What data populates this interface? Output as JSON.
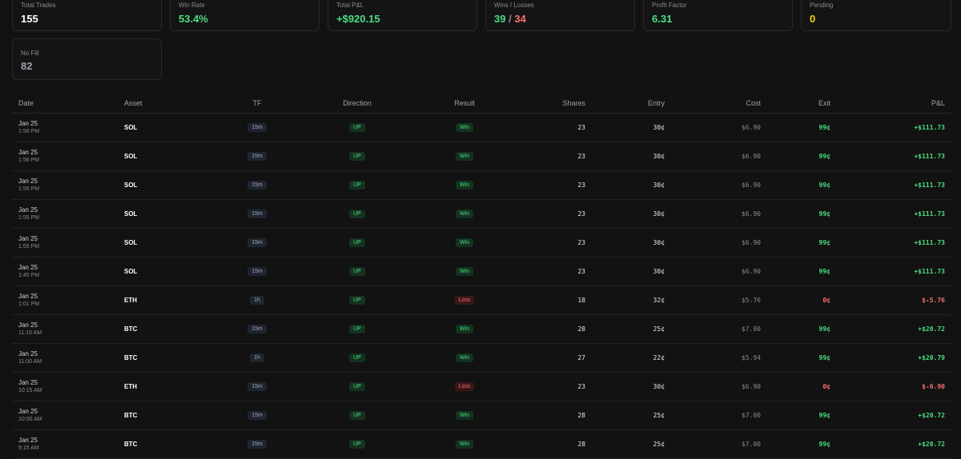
{
  "stats": [
    {
      "label": "Total Trades",
      "value": "155",
      "color": "white"
    },
    {
      "label": "Win Rate",
      "value": "53.4%",
      "color": "green"
    },
    {
      "label": "Total P&L",
      "value": "+$920.15",
      "color": "green"
    },
    {
      "label": "Wins / Losses",
      "wins": "39",
      "losses": "34",
      "separator": "/"
    },
    {
      "label": "Profit Factor",
      "value": "6.31",
      "color": "green"
    },
    {
      "label": "Pending",
      "value": "0",
      "color": "yellow"
    },
    {
      "label": "No Fill",
      "value": "82",
      "color": "grey"
    }
  ],
  "table": {
    "headers": {
      "date": "Date",
      "asset": "Asset",
      "tf": "TF",
      "direction": "Direction",
      "result": "Result",
      "shares": "Shares",
      "entry": "Entry",
      "cost": "Cost",
      "exit": "Exit",
      "pnl": "P&L"
    },
    "rows": [
      {
        "date": "Jan 25",
        "time": "1:56 PM",
        "asset": "SOL",
        "tf": "15m",
        "direction": "UP",
        "result": "Win",
        "shares": "23",
        "entry": "30¢",
        "cost": "$6.90",
        "exit": "99¢",
        "pnl": "+$111.73"
      },
      {
        "date": "Jan 25",
        "time": "1:56 PM",
        "asset": "SOL",
        "tf": "15m",
        "direction": "UP",
        "result": "Win",
        "shares": "23",
        "entry": "30¢",
        "cost": "$6.90",
        "exit": "99¢",
        "pnl": "+$111.73"
      },
      {
        "date": "Jan 25",
        "time": "1:56 PM",
        "asset": "SOL",
        "tf": "15m",
        "direction": "UP",
        "result": "Win",
        "shares": "23",
        "entry": "30¢",
        "cost": "$6.90",
        "exit": "99¢",
        "pnl": "+$111.73"
      },
      {
        "date": "Jan 25",
        "time": "1:55 PM",
        "asset": "SOL",
        "tf": "15m",
        "direction": "UP",
        "result": "Win",
        "shares": "23",
        "entry": "30¢",
        "cost": "$6.90",
        "exit": "99¢",
        "pnl": "+$111.73"
      },
      {
        "date": "Jan 25",
        "time": "1:55 PM",
        "asset": "SOL",
        "tf": "15m",
        "direction": "UP",
        "result": "Win",
        "shares": "23",
        "entry": "30¢",
        "cost": "$6.90",
        "exit": "99¢",
        "pnl": "+$111.73"
      },
      {
        "date": "Jan 25",
        "time": "1:45 PM",
        "asset": "SOL",
        "tf": "15m",
        "direction": "UP",
        "result": "Win",
        "shares": "23",
        "entry": "30¢",
        "cost": "$6.90",
        "exit": "99¢",
        "pnl": "+$111.73"
      },
      {
        "date": "Jan 25",
        "time": "1:01 PM",
        "asset": "ETH",
        "tf": "1h",
        "direction": "UP",
        "result": "Loss",
        "shares": "18",
        "entry": "32¢",
        "cost": "$5.76",
        "exit": "0¢",
        "pnl": "$-5.76"
      },
      {
        "date": "Jan 25",
        "time": "11:15 AM",
        "asset": "BTC",
        "tf": "15m",
        "direction": "UP",
        "result": "Win",
        "shares": "28",
        "entry": "25¢",
        "cost": "$7.00",
        "exit": "99¢",
        "pnl": "+$20.72"
      },
      {
        "date": "Jan 25",
        "time": "11:00 AM",
        "asset": "BTC",
        "tf": "1h",
        "direction": "UP",
        "result": "Win",
        "shares": "27",
        "entry": "22¢",
        "cost": "$5.94",
        "exit": "99¢",
        "pnl": "+$20.79"
      },
      {
        "date": "Jan 25",
        "time": "10:15 AM",
        "asset": "ETH",
        "tf": "15m",
        "direction": "UP",
        "result": "Loss",
        "shares": "23",
        "entry": "30¢",
        "cost": "$6.90",
        "exit": "0¢",
        "pnl": "$-6.90"
      },
      {
        "date": "Jan 25",
        "time": "10:00 AM",
        "asset": "BTC",
        "tf": "15m",
        "direction": "UP",
        "result": "Win",
        "shares": "28",
        "entry": "25¢",
        "cost": "$7.00",
        "exit": "99¢",
        "pnl": "+$20.72"
      },
      {
        "date": "Jan 25",
        "time": "9:15 AM",
        "asset": "BTC",
        "tf": "15m",
        "direction": "UP",
        "result": "Win",
        "shares": "28",
        "entry": "25¢",
        "cost": "$7.00",
        "exit": "99¢",
        "pnl": "+$20.72"
      }
    ]
  }
}
